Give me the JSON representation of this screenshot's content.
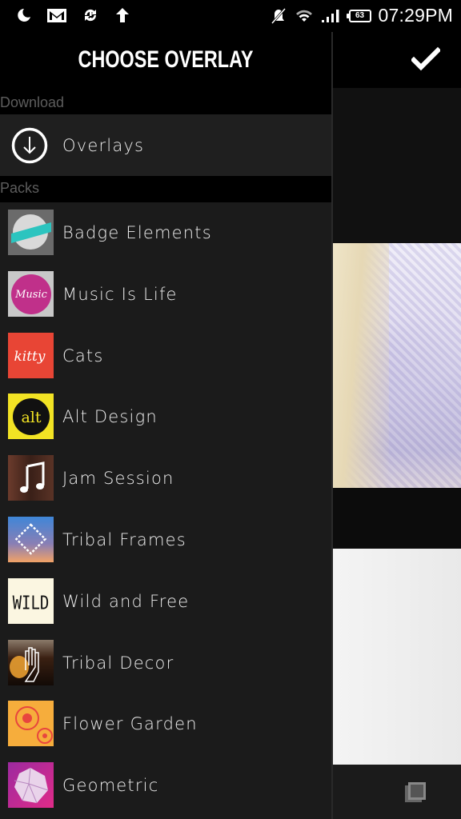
{
  "status_bar": {
    "left_icons": [
      "moon-icon",
      "gmail-icon",
      "sync-alert-icon",
      "upload-arrow-icon"
    ],
    "right_icons": [
      "muted-bell-icon",
      "wifi-icon",
      "signal-icon",
      "battery-icon"
    ],
    "battery_level": "63",
    "time": "07:29PM"
  },
  "drawer": {
    "title": "CHOOSE OVERLAY",
    "sections": {
      "download": {
        "label": "Download",
        "item": {
          "label": "Overlays",
          "icon": "download-circle-icon"
        }
      },
      "packs": {
        "label": "Packs",
        "items": [
          {
            "label": "Badge Elements",
            "thumb": "badge-elements-thumbnail",
            "colors": [
              "#6b6b6b",
              "#2cc4bf",
              "#d9d9d9"
            ]
          },
          {
            "label": "Music Is Life",
            "thumb": "music-is-life-thumbnail",
            "colors": [
              "#c8c8c8",
              "#c0308a",
              "#ffffff"
            ]
          },
          {
            "label": "Cats",
            "thumb": "cats-thumbnail",
            "colors": [
              "#e84535",
              "#ffffff"
            ]
          },
          {
            "label": "Alt Design",
            "thumb": "alt-design-thumbnail",
            "colors": [
              "#f2e324",
              "#111111"
            ]
          },
          {
            "label": "Jam Session",
            "thumb": "jam-session-thumbnail",
            "colors": [
              "#4a2a22",
              "#ffffff"
            ]
          },
          {
            "label": "Tribal Frames",
            "thumb": "tribal-frames-thumbnail",
            "colors": [
              "#3f86d8",
              "#f2a266",
              "#ffffff"
            ]
          },
          {
            "label": "Wild and Free",
            "thumb": "wild-and-free-thumbnail",
            "colors": [
              "#fbf6e1",
              "#111111"
            ]
          },
          {
            "label": "Tribal Decor",
            "thumb": "tribal-decor-thumbnail",
            "colors": [
              "#2a1a10",
              "#f3a632",
              "#ffffff"
            ]
          },
          {
            "label": "Flower Garden",
            "thumb": "flower-garden-thumbnail",
            "colors": [
              "#f6ad3c",
              "#e8463e"
            ]
          },
          {
            "label": "Geometric",
            "thumb": "geometric-thumbnail",
            "colors": [
              "#c2289a",
              "#e9d3ea"
            ]
          }
        ]
      }
    }
  },
  "content": {
    "confirm_icon": "checkmark-icon",
    "bottom_icon": "layers-icon"
  }
}
